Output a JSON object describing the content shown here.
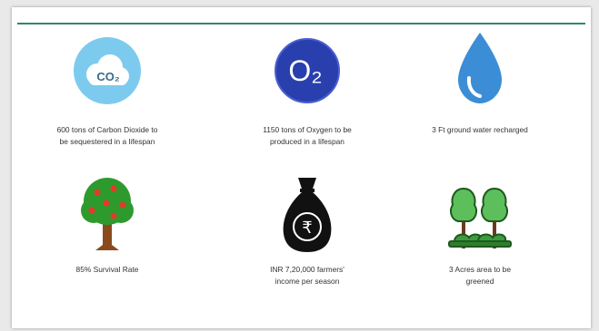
{
  "stats": [
    {
      "id": "co2",
      "icon": "co2-cloud-icon",
      "caption": "600 tons of Carbon Dioxide to\nbe sequestered in a lifespan",
      "icon_text": "CO₂",
      "color": "#76c8ec"
    },
    {
      "id": "o2",
      "icon": "oxygen-icon",
      "caption": "1150 tons of Oxygen to be\nproduced in a lifespan",
      "icon_text": "O₂",
      "color": "#2b3fae"
    },
    {
      "id": "water",
      "icon": "water-drop-icon",
      "caption": "3 Ft ground water recharged",
      "color": "#3d8fd6"
    },
    {
      "id": "tree",
      "icon": "fruit-tree-icon",
      "caption": "85% Survival Rate",
      "color": "#2e8b2e"
    },
    {
      "id": "bag",
      "icon": "rupee-money-bag-icon",
      "caption": "INR 7,20,000 farmers'\nincome per season",
      "icon_text": "₹",
      "color": "#111111"
    },
    {
      "id": "forest",
      "icon": "forest-trees-icon",
      "caption": "3 Acres area to be\ngreened",
      "color": "#4caf50"
    }
  ],
  "colors": {
    "accent_rule": "#2f8a64"
  }
}
